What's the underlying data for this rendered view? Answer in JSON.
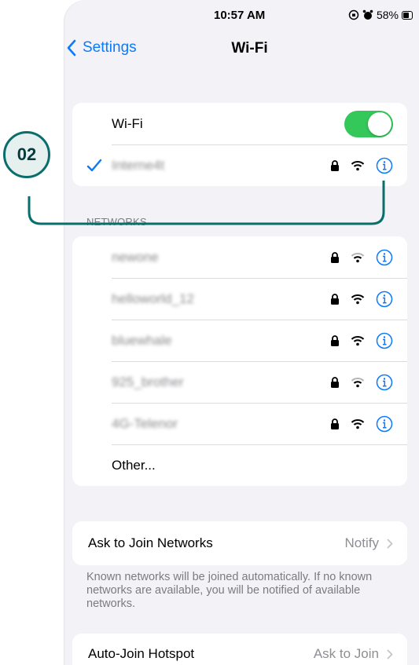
{
  "status_bar": {
    "time": "10:57 AM",
    "battery": "58%"
  },
  "nav": {
    "back_label": "Settings",
    "title": "Wi-Fi"
  },
  "wifi_card": {
    "toggle_label": "Wi-Fi",
    "toggle_on": true,
    "connected_network": "Interne4t"
  },
  "networks": {
    "header": "NETWORKS",
    "items": [
      {
        "name": "newone",
        "locked": true,
        "signal": "medium"
      },
      {
        "name": "helloworld_12",
        "locked": true,
        "signal": "full"
      },
      {
        "name": "bluewhale",
        "locked": true,
        "signal": "full"
      },
      {
        "name": "925_brother",
        "locked": true,
        "signal": "medium"
      },
      {
        "name": "4G-Telenor",
        "locked": true,
        "signal": "full"
      }
    ],
    "other_label": "Other..."
  },
  "ask_to_join": {
    "label": "Ask to Join Networks",
    "value": "Notify",
    "footer": "Known networks will be joined automatically. If no known networks are available, you will be notified of available networks."
  },
  "auto_join": {
    "label": "Auto-Join Hotspot",
    "value": "Ask to Join"
  },
  "annotation": {
    "step": "02",
    "color": "#0a6e6c"
  },
  "colors": {
    "accent": "#0a7aff",
    "toggle_on": "#34c759",
    "background": "#f2f2f7"
  },
  "icons": [
    "chevron-left-icon",
    "checkmark-icon",
    "lock-icon",
    "wifi-icon",
    "info-icon",
    "chevron-right-icon",
    "alarm-icon",
    "rotation-lock-icon",
    "battery-icon"
  ]
}
